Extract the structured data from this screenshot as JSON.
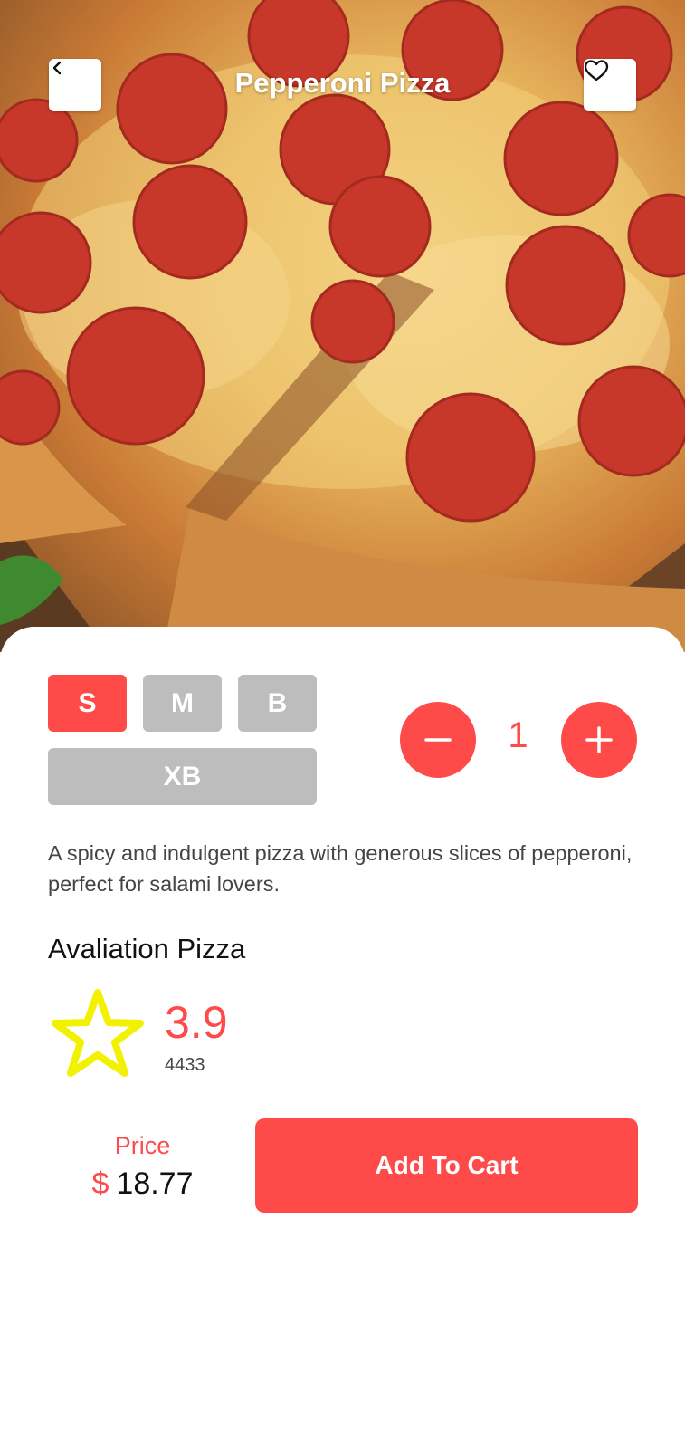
{
  "header": {
    "title": "Pepperoni Pizza",
    "back_icon": "chevron-left-icon",
    "favorite_icon": "heart-icon"
  },
  "sizes": [
    {
      "label": "S",
      "selected": true
    },
    {
      "label": "M",
      "selected": false
    },
    {
      "label": "B",
      "selected": false
    },
    {
      "label": "XB",
      "selected": false
    }
  ],
  "quantity": {
    "value": "1",
    "minus_icon": "minus-icon",
    "plus_icon": "plus-icon"
  },
  "description": "A spicy and indulgent pizza with generous slices of pepperoni, perfect for salami lovers.",
  "rating": {
    "heading": "Avaliation Pizza",
    "value": "3.9",
    "count": "4433",
    "icon": "star-icon"
  },
  "price": {
    "label": "Price",
    "currency": "$",
    "amount": "18.77"
  },
  "cart_button": {
    "label": "Add To Cart"
  },
  "colors": {
    "accent": "#ff4a4a",
    "inactive": "#bdbdbd",
    "star": "#f7f700"
  }
}
